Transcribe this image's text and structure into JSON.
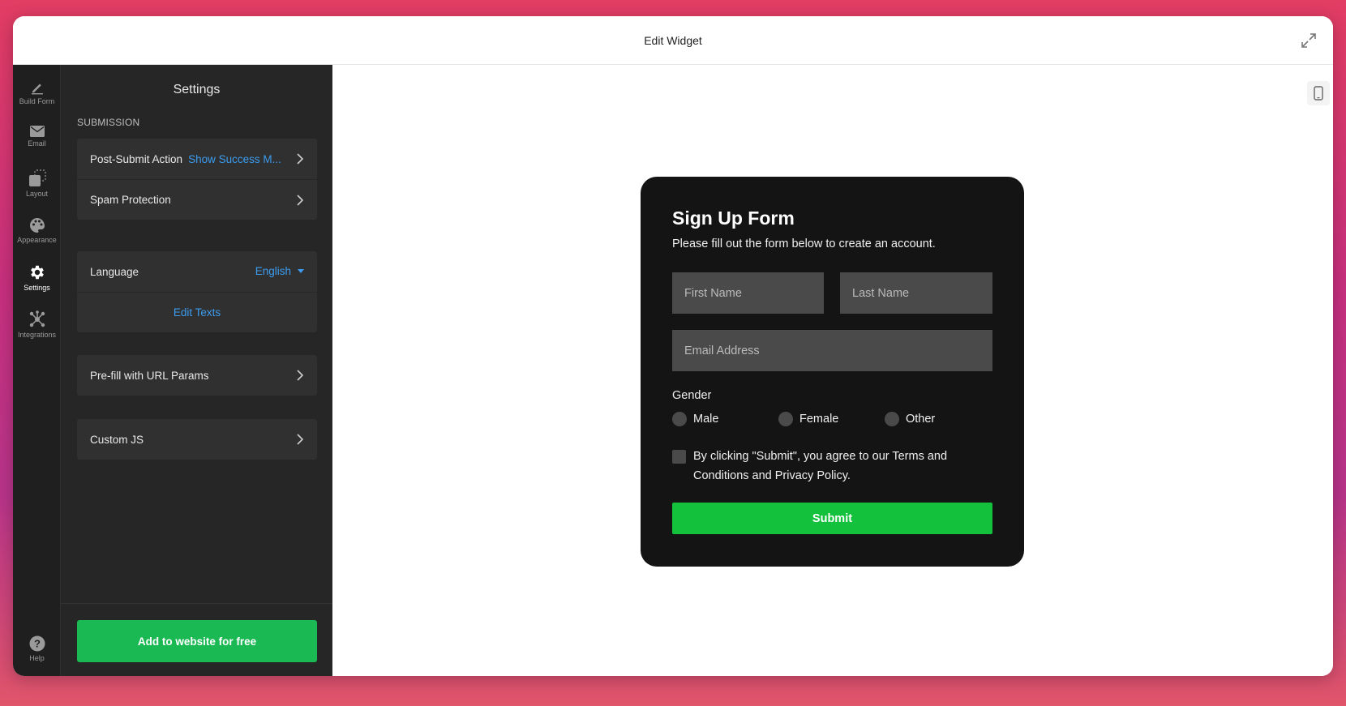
{
  "window": {
    "title": "Edit Widget"
  },
  "rail": {
    "items": [
      {
        "label": "Build Form",
        "icon": "pencil-icon"
      },
      {
        "label": "Email",
        "icon": "envelope-icon"
      },
      {
        "label": "Layout",
        "icon": "layout-icon"
      },
      {
        "label": "Appearance",
        "icon": "palette-icon"
      },
      {
        "label": "Settings",
        "icon": "gear-icon",
        "active": true
      },
      {
        "label": "Integrations",
        "icon": "integrations-icon"
      }
    ],
    "help": {
      "label": "Help",
      "icon": "help-icon"
    }
  },
  "panel": {
    "title": "Settings",
    "section_label": "SUBMISSION",
    "post_submit": {
      "label": "Post-Submit Action",
      "value": "Show Success M..."
    },
    "spam": {
      "label": "Spam Protection"
    },
    "language": {
      "label": "Language",
      "value": "English"
    },
    "edit_texts": {
      "label": "Edit Texts"
    },
    "prefill": {
      "label": "Pre-fill with URL Params"
    },
    "custom_js": {
      "label": "Custom JS"
    },
    "add_button": {
      "label": "Add to website for free"
    }
  },
  "form": {
    "title": "Sign Up Form",
    "subtitle": "Please fill out the form below to create an account.",
    "first_name": {
      "placeholder": "First Name",
      "value": ""
    },
    "last_name": {
      "placeholder": "Last Name",
      "value": ""
    },
    "email": {
      "placeholder": "Email Address",
      "value": ""
    },
    "gender_label": "Gender",
    "gender_options": [
      "Male",
      "Female",
      "Other"
    ],
    "consent": "By clicking \"Submit\", you agree to our Terms and Conditions and Privacy Policy.",
    "submit_label": "Submit"
  },
  "colors": {
    "accent_green": "#1bb953",
    "submit_green": "#13c13d",
    "link_blue": "#3b9cf0",
    "panel_bg": "#262626",
    "form_bg": "#141414"
  }
}
